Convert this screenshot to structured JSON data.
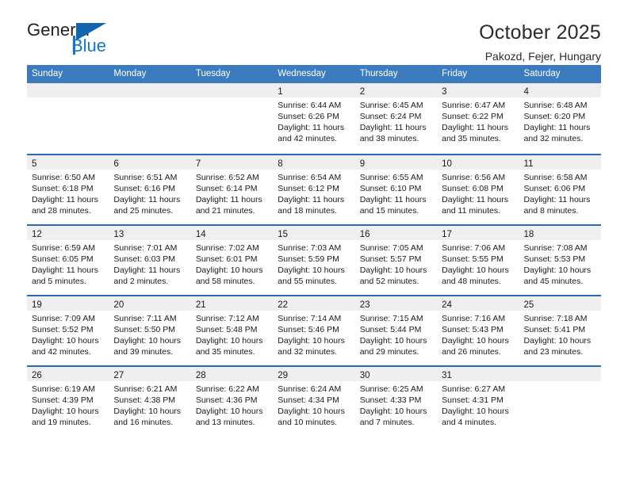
{
  "brand": {
    "name_top": "General",
    "name_bottom": "Blue",
    "accent_color": "#1877c4",
    "triangle_color": "#1065ad"
  },
  "header": {
    "title": "October 2025",
    "subtitle": "Pakozd, Fejer, Hungary"
  },
  "calendar": {
    "header_bg": "#3c7cbe",
    "row_divider_color": "#2a6ab0",
    "day_band_bg": "#efefef",
    "weekdays": [
      "Sunday",
      "Monday",
      "Tuesday",
      "Wednesday",
      "Thursday",
      "Friday",
      "Saturday"
    ],
    "weeks": [
      [
        {
          "day": "",
          "sunrise": "",
          "sunset": "",
          "daylight_line1": "",
          "daylight_line2": ""
        },
        {
          "day": "",
          "sunrise": "",
          "sunset": "",
          "daylight_line1": "",
          "daylight_line2": ""
        },
        {
          "day": "",
          "sunrise": "",
          "sunset": "",
          "daylight_line1": "",
          "daylight_line2": ""
        },
        {
          "day": "1",
          "sunrise": "Sunrise: 6:44 AM",
          "sunset": "Sunset: 6:26 PM",
          "daylight_line1": "Daylight: 11 hours",
          "daylight_line2": "and 42 minutes."
        },
        {
          "day": "2",
          "sunrise": "Sunrise: 6:45 AM",
          "sunset": "Sunset: 6:24 PM",
          "daylight_line1": "Daylight: 11 hours",
          "daylight_line2": "and 38 minutes."
        },
        {
          "day": "3",
          "sunrise": "Sunrise: 6:47 AM",
          "sunset": "Sunset: 6:22 PM",
          "daylight_line1": "Daylight: 11 hours",
          "daylight_line2": "and 35 minutes."
        },
        {
          "day": "4",
          "sunrise": "Sunrise: 6:48 AM",
          "sunset": "Sunset: 6:20 PM",
          "daylight_line1": "Daylight: 11 hours",
          "daylight_line2": "and 32 minutes."
        }
      ],
      [
        {
          "day": "5",
          "sunrise": "Sunrise: 6:50 AM",
          "sunset": "Sunset: 6:18 PM",
          "daylight_line1": "Daylight: 11 hours",
          "daylight_line2": "and 28 minutes."
        },
        {
          "day": "6",
          "sunrise": "Sunrise: 6:51 AM",
          "sunset": "Sunset: 6:16 PM",
          "daylight_line1": "Daylight: 11 hours",
          "daylight_line2": "and 25 minutes."
        },
        {
          "day": "7",
          "sunrise": "Sunrise: 6:52 AM",
          "sunset": "Sunset: 6:14 PM",
          "daylight_line1": "Daylight: 11 hours",
          "daylight_line2": "and 21 minutes."
        },
        {
          "day": "8",
          "sunrise": "Sunrise: 6:54 AM",
          "sunset": "Sunset: 6:12 PM",
          "daylight_line1": "Daylight: 11 hours",
          "daylight_line2": "and 18 minutes."
        },
        {
          "day": "9",
          "sunrise": "Sunrise: 6:55 AM",
          "sunset": "Sunset: 6:10 PM",
          "daylight_line1": "Daylight: 11 hours",
          "daylight_line2": "and 15 minutes."
        },
        {
          "day": "10",
          "sunrise": "Sunrise: 6:56 AM",
          "sunset": "Sunset: 6:08 PM",
          "daylight_line1": "Daylight: 11 hours",
          "daylight_line2": "and 11 minutes."
        },
        {
          "day": "11",
          "sunrise": "Sunrise: 6:58 AM",
          "sunset": "Sunset: 6:06 PM",
          "daylight_line1": "Daylight: 11 hours",
          "daylight_line2": "and 8 minutes."
        }
      ],
      [
        {
          "day": "12",
          "sunrise": "Sunrise: 6:59 AM",
          "sunset": "Sunset: 6:05 PM",
          "daylight_line1": "Daylight: 11 hours",
          "daylight_line2": "and 5 minutes."
        },
        {
          "day": "13",
          "sunrise": "Sunrise: 7:01 AM",
          "sunset": "Sunset: 6:03 PM",
          "daylight_line1": "Daylight: 11 hours",
          "daylight_line2": "and 2 minutes."
        },
        {
          "day": "14",
          "sunrise": "Sunrise: 7:02 AM",
          "sunset": "Sunset: 6:01 PM",
          "daylight_line1": "Daylight: 10 hours",
          "daylight_line2": "and 58 minutes."
        },
        {
          "day": "15",
          "sunrise": "Sunrise: 7:03 AM",
          "sunset": "Sunset: 5:59 PM",
          "daylight_line1": "Daylight: 10 hours",
          "daylight_line2": "and 55 minutes."
        },
        {
          "day": "16",
          "sunrise": "Sunrise: 7:05 AM",
          "sunset": "Sunset: 5:57 PM",
          "daylight_line1": "Daylight: 10 hours",
          "daylight_line2": "and 52 minutes."
        },
        {
          "day": "17",
          "sunrise": "Sunrise: 7:06 AM",
          "sunset": "Sunset: 5:55 PM",
          "daylight_line1": "Daylight: 10 hours",
          "daylight_line2": "and 48 minutes."
        },
        {
          "day": "18",
          "sunrise": "Sunrise: 7:08 AM",
          "sunset": "Sunset: 5:53 PM",
          "daylight_line1": "Daylight: 10 hours",
          "daylight_line2": "and 45 minutes."
        }
      ],
      [
        {
          "day": "19",
          "sunrise": "Sunrise: 7:09 AM",
          "sunset": "Sunset: 5:52 PM",
          "daylight_line1": "Daylight: 10 hours",
          "daylight_line2": "and 42 minutes."
        },
        {
          "day": "20",
          "sunrise": "Sunrise: 7:11 AM",
          "sunset": "Sunset: 5:50 PM",
          "daylight_line1": "Daylight: 10 hours",
          "daylight_line2": "and 39 minutes."
        },
        {
          "day": "21",
          "sunrise": "Sunrise: 7:12 AM",
          "sunset": "Sunset: 5:48 PM",
          "daylight_line1": "Daylight: 10 hours",
          "daylight_line2": "and 35 minutes."
        },
        {
          "day": "22",
          "sunrise": "Sunrise: 7:14 AM",
          "sunset": "Sunset: 5:46 PM",
          "daylight_line1": "Daylight: 10 hours",
          "daylight_line2": "and 32 minutes."
        },
        {
          "day": "23",
          "sunrise": "Sunrise: 7:15 AM",
          "sunset": "Sunset: 5:44 PM",
          "daylight_line1": "Daylight: 10 hours",
          "daylight_line2": "and 29 minutes."
        },
        {
          "day": "24",
          "sunrise": "Sunrise: 7:16 AM",
          "sunset": "Sunset: 5:43 PM",
          "daylight_line1": "Daylight: 10 hours",
          "daylight_line2": "and 26 minutes."
        },
        {
          "day": "25",
          "sunrise": "Sunrise: 7:18 AM",
          "sunset": "Sunset: 5:41 PM",
          "daylight_line1": "Daylight: 10 hours",
          "daylight_line2": "and 23 minutes."
        }
      ],
      [
        {
          "day": "26",
          "sunrise": "Sunrise: 6:19 AM",
          "sunset": "Sunset: 4:39 PM",
          "daylight_line1": "Daylight: 10 hours",
          "daylight_line2": "and 19 minutes."
        },
        {
          "day": "27",
          "sunrise": "Sunrise: 6:21 AM",
          "sunset": "Sunset: 4:38 PM",
          "daylight_line1": "Daylight: 10 hours",
          "daylight_line2": "and 16 minutes."
        },
        {
          "day": "28",
          "sunrise": "Sunrise: 6:22 AM",
          "sunset": "Sunset: 4:36 PM",
          "daylight_line1": "Daylight: 10 hours",
          "daylight_line2": "and 13 minutes."
        },
        {
          "day": "29",
          "sunrise": "Sunrise: 6:24 AM",
          "sunset": "Sunset: 4:34 PM",
          "daylight_line1": "Daylight: 10 hours",
          "daylight_line2": "and 10 minutes."
        },
        {
          "day": "30",
          "sunrise": "Sunrise: 6:25 AM",
          "sunset": "Sunset: 4:33 PM",
          "daylight_line1": "Daylight: 10 hours",
          "daylight_line2": "and 7 minutes."
        },
        {
          "day": "31",
          "sunrise": "Sunrise: 6:27 AM",
          "sunset": "Sunset: 4:31 PM",
          "daylight_line1": "Daylight: 10 hours",
          "daylight_line2": "and 4 minutes."
        },
        {
          "day": "",
          "sunrise": "",
          "sunset": "",
          "daylight_line1": "",
          "daylight_line2": ""
        }
      ]
    ]
  }
}
